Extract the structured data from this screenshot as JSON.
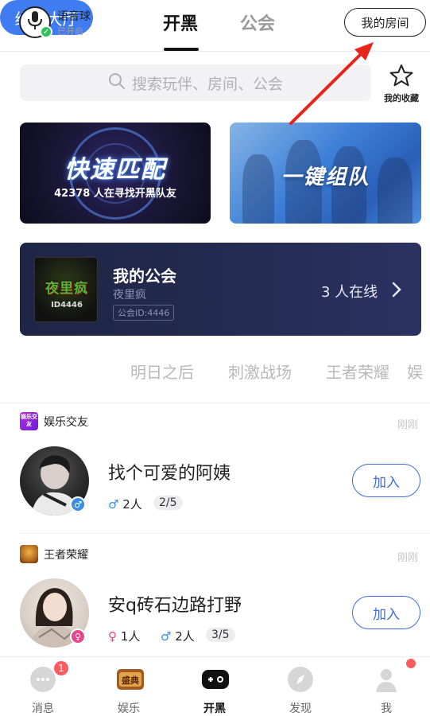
{
  "header": {
    "voice_ball_title": "语音球",
    "voice_ball_status": "已开启",
    "tabs": [
      {
        "label": "开黑",
        "active": true
      },
      {
        "label": "公会",
        "active": false
      }
    ],
    "my_room_label": "我的房间"
  },
  "search": {
    "placeholder": "搜索玩伴、房间、公会",
    "favorites_label": "我的收藏"
  },
  "banners": {
    "quick_match": {
      "title": "快速匹配",
      "subtitle": "42378 人在寻找开黑队友"
    },
    "team_up": {
      "title": "一键组队"
    }
  },
  "guild": {
    "title": "我的公会",
    "name": "夜里疯",
    "id_label": "公会ID:4446",
    "online": "3 人在线",
    "logo_text": "夜里疯",
    "logo_id": "ID4446"
  },
  "categories": [
    {
      "label": "组队大厅",
      "active": true
    },
    {
      "label": "明日之后",
      "active": false
    },
    {
      "label": "刺激战场",
      "active": false
    },
    {
      "label": "王者荣耀",
      "active": false
    },
    {
      "label": "娱",
      "active": false
    }
  ],
  "rooms": [
    {
      "game": "娱乐交友",
      "game_icon_text": "娱乐交友",
      "time": "刚刚",
      "title": "找个可爱的阿姨",
      "male_count": "2人",
      "capacity": "2/5",
      "join_label": "加入"
    },
    {
      "game": "王者荣耀",
      "time": "刚刚",
      "title": "安q砖石边路打野",
      "female_count": "1人",
      "male_count": "2人",
      "capacity": "3/5",
      "join_label": "加入"
    }
  ],
  "bottom_nav": [
    {
      "label": "消息",
      "badge": "1",
      "active": false
    },
    {
      "label": "娱乐",
      "active": false
    },
    {
      "label": "开黑",
      "active": true
    },
    {
      "label": "发现",
      "active": false
    },
    {
      "label": "我",
      "dot": true,
      "active": false
    }
  ],
  "colors": {
    "accent_blue": "#3f7bf1",
    "join_blue": "#3f6de0",
    "badge_red": "#ff5a5f",
    "male_blue": "#3a8ee6",
    "female_pink": "#e8458b",
    "annotation_red": "#e8231a"
  }
}
